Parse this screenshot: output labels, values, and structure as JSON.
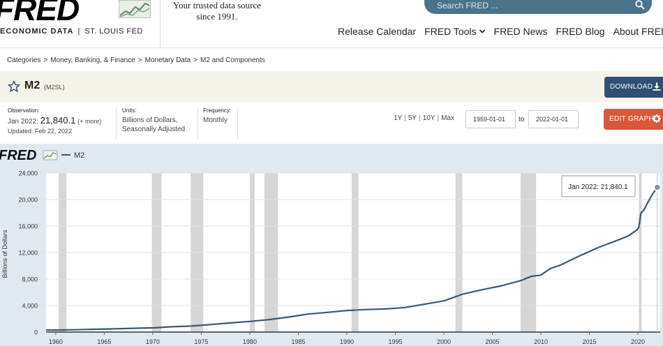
{
  "header": {
    "logo_text": "FRED",
    "logo_sub_left": "ECONOMIC DATA",
    "logo_sub_sep": "|",
    "logo_sub_right": "ST. LOUIS FED",
    "tagline_line1": "Your trusted data source",
    "tagline_line2": "since 1991.",
    "search_placeholder": "Search FRED ...",
    "nav": [
      {
        "label": "Release Calendar",
        "dropdown": false
      },
      {
        "label": "FRED Tools",
        "dropdown": true
      },
      {
        "label": "FRED News",
        "dropdown": false
      },
      {
        "label": "FRED Blog",
        "dropdown": false
      },
      {
        "label": "About FRED",
        "dropdown": true
      }
    ]
  },
  "breadcrumb": [
    "Categories",
    "Money, Banking, & Finance",
    "Monetary Data",
    "M2 and Components"
  ],
  "series": {
    "title": "M2",
    "id": "(M2SL)",
    "download_label": "DOWNLOAD",
    "edit_graph_label": "EDIT GRAPH"
  },
  "meta": {
    "observation_label": "Observation:",
    "observation_date": "Jan 2022:",
    "observation_value": "21,840.1",
    "observation_more": "(+ more)",
    "updated": "Updated: Feb 22, 2022",
    "units_label": "Units:",
    "units_line1": "Billions of Dollars,",
    "units_line2": "Seasonally Adjusted",
    "frequency_label": "Frequency:",
    "frequency_value": "Monthly"
  },
  "range": {
    "options": [
      "1Y",
      "5Y",
      "10Y",
      "Max"
    ],
    "start": "1959-01-01",
    "to_label": "to",
    "end": "2022-01-01"
  },
  "colors": {
    "accent_blue": "#2f4f73",
    "accent_orange": "#d9573b",
    "line": "#3a5876",
    "recession": "#d6d6d6",
    "chart_bg": "#e1e9f0"
  },
  "chart_data": {
    "type": "line",
    "legend_logo": "FRED",
    "legend_label": "M2",
    "ylabel": "Billions of Dollars",
    "xlim": [
      1959,
      2022.3
    ],
    "ylim": [
      0,
      24000
    ],
    "yticks": [
      0,
      4000,
      8000,
      12000,
      16000,
      20000,
      24000
    ],
    "ytick_labels": [
      "0",
      "4,000",
      "8,000",
      "12,000",
      "16,000",
      "20,000",
      "24,000"
    ],
    "xticks": [
      1960,
      1965,
      1970,
      1975,
      1980,
      1985,
      1990,
      1995,
      2000,
      2005,
      2010,
      2015,
      2020
    ],
    "grid": true,
    "recessions": [
      [
        1960.3,
        1961.1
      ],
      [
        1969.9,
        1970.9
      ],
      [
        1973.9,
        1975.2
      ],
      [
        1980.0,
        1980.5
      ],
      [
        1981.5,
        1982.9
      ],
      [
        1990.5,
        1991.2
      ],
      [
        2001.2,
        2001.9
      ],
      [
        2007.9,
        2009.5
      ],
      [
        2020.1,
        2020.4
      ]
    ],
    "x": [
      1959,
      1960,
      1962,
      1964,
      1966,
      1968,
      1970,
      1972,
      1974,
      1976,
      1978,
      1980,
      1982,
      1984,
      1986,
      1988,
      1990,
      1992,
      1994,
      1996,
      1998,
      2000,
      2002,
      2004,
      2006,
      2008,
      2009,
      2010,
      2011,
      2012,
      2014,
      2016,
      2018,
      2019,
      2019.9,
      2020.1,
      2020.3,
      2020.6,
      2021,
      2021.5,
      2022
    ],
    "values": [
      290,
      310,
      350,
      420,
      480,
      570,
      630,
      800,
      900,
      1140,
      1380,
      1600,
      1880,
      2260,
      2720,
      2970,
      3250,
      3400,
      3480,
      3700,
      4200,
      4700,
      5750,
      6400,
      7000,
      7800,
      8400,
      8600,
      9600,
      10100,
      11500,
      12800,
      13900,
      14500,
      15400,
      15800,
      17900,
      18400,
      19500,
      20800,
      21840.1
    ],
    "tooltip": {
      "label": "Jan 2022:",
      "value": "21,840.1"
    }
  }
}
